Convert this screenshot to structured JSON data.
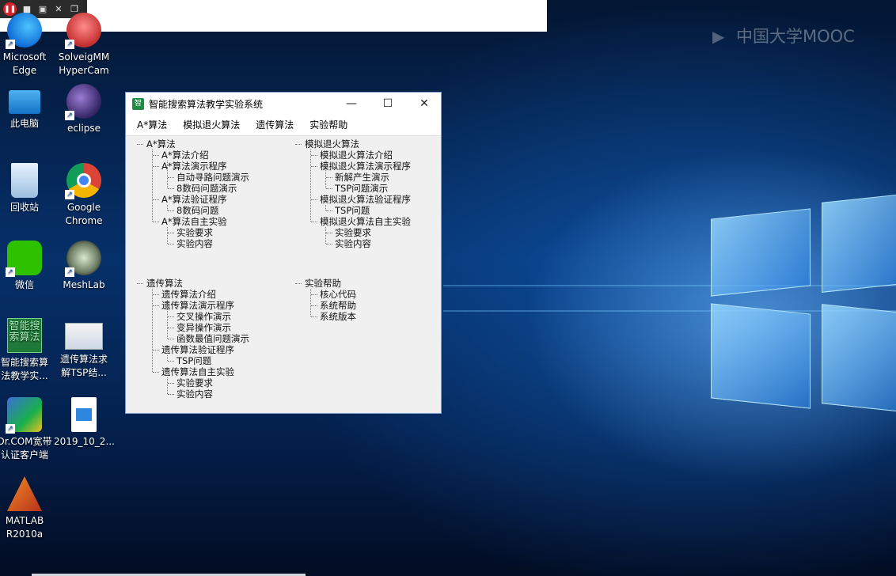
{
  "watermark": "中国大学MOOC",
  "desktop_icons": [
    {
      "label1": "Microsoft",
      "label2": "Edge"
    },
    {
      "label1": "SolveigMM",
      "label2": "HyperCam"
    },
    {
      "label1": "此电脑",
      "label2": ""
    },
    {
      "label1": "eclipse",
      "label2": ""
    },
    {
      "label1": "回收站",
      "label2": ""
    },
    {
      "label1": "Google",
      "label2": "Chrome"
    },
    {
      "label1": "微信",
      "label2": ""
    },
    {
      "label1": "MeshLab",
      "label2": ""
    },
    {
      "label1": "智能搜索算",
      "label2": "法教学实..."
    },
    {
      "label1": "遗传算法求",
      "label2": "解TSP结..."
    },
    {
      "label1": "Dr.COM宽带",
      "label2": "认证客户端"
    },
    {
      "label1": "2019_10_2...",
      "label2": ""
    },
    {
      "label1": "MATLAB",
      "label2": "R2010a"
    }
  ],
  "shortcut_glyph": "↗",
  "zhi_icon_text": "智能搜索算法",
  "window": {
    "title": "智能搜索算法教学实验系统",
    "app_icon_text": "智",
    "menu": [
      "A*算法",
      "模拟退火算法",
      "遗传算法",
      "实验帮助"
    ],
    "tree_astar": [
      "A*算法",
      "A*算法介绍",
      "A*算法演示程序",
      "自动寻路问题演示",
      "8数码问题演示",
      "A*算法验证程序",
      "8数码问题",
      "A*算法自主实验",
      "实验要求",
      "实验内容"
    ],
    "tree_sa": [
      "模拟退火算法",
      "模拟退火算法介绍",
      "模拟退火算法演示程序",
      "新解产生演示",
      "TSP问题演示",
      "模拟退火算法验证程序",
      "TSP问题",
      "模拟退火算法自主实验",
      "实验要求",
      "实验内容"
    ],
    "tree_ga": [
      "遗传算法",
      "遗传算法介绍",
      "遗传算法演示程序",
      "交叉操作演示",
      "变异操作演示",
      "函数最值问题演示",
      "遗传算法验证程序",
      "TSP问题",
      "遗传算法自主实验",
      "实验要求",
      "实验内容"
    ],
    "tree_help": [
      "实验帮助",
      "核心代码",
      "系统帮助",
      "系统版本"
    ]
  }
}
